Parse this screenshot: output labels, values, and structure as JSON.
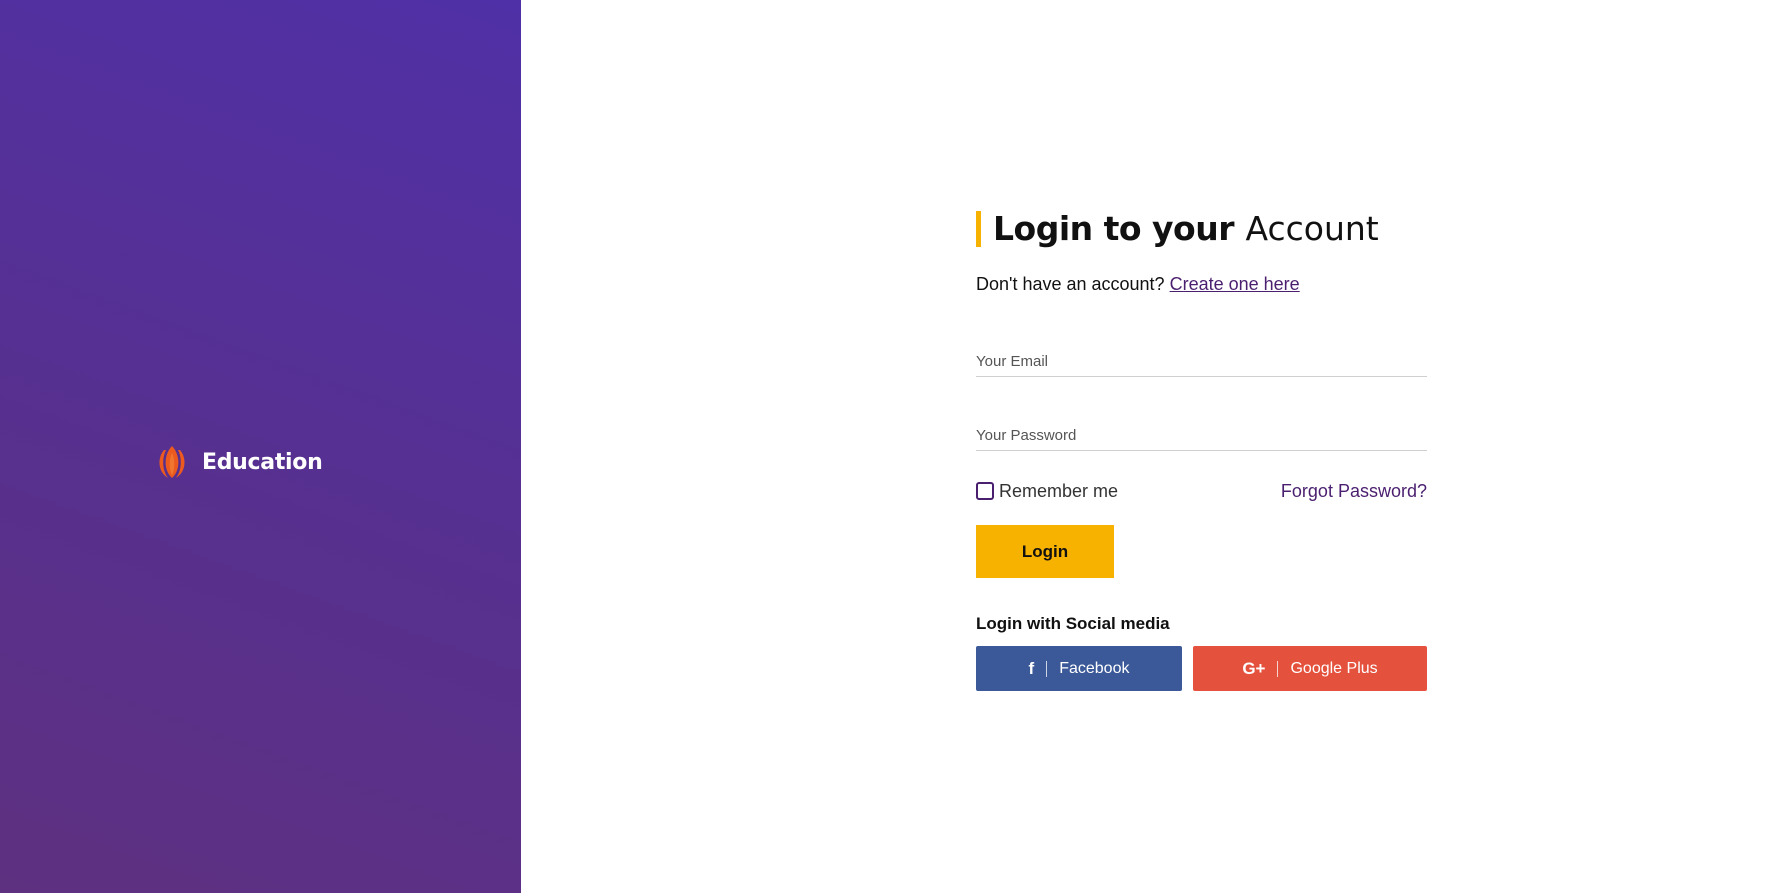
{
  "brand": {
    "name": "Education",
    "logo_icon": "flame-leaf-icon",
    "panel_colors": [
      "#5030a6",
      "#5e3080"
    ],
    "logo_color": "#ec5a1f"
  },
  "login": {
    "title_bold": "Login to your",
    "title_light": "Account",
    "accent_color": "#f7b200",
    "signup_prompt": "Don't have an account?",
    "signup_link": "Create one here",
    "email_placeholder": "Your Email",
    "password_placeholder": "Your Password",
    "remember_label": "Remember me",
    "remember_checked": false,
    "forgot_link": "Forgot Password?",
    "login_button": "Login"
  },
  "social": {
    "heading": "Login with Social media",
    "buttons": [
      {
        "label": "Facebook",
        "icon": "facebook-icon",
        "glyph": "f",
        "color": "#3b5998"
      },
      {
        "label": "Google Plus",
        "icon": "google-plus-icon",
        "glyph": "G+",
        "color": "#e4513d"
      }
    ]
  }
}
